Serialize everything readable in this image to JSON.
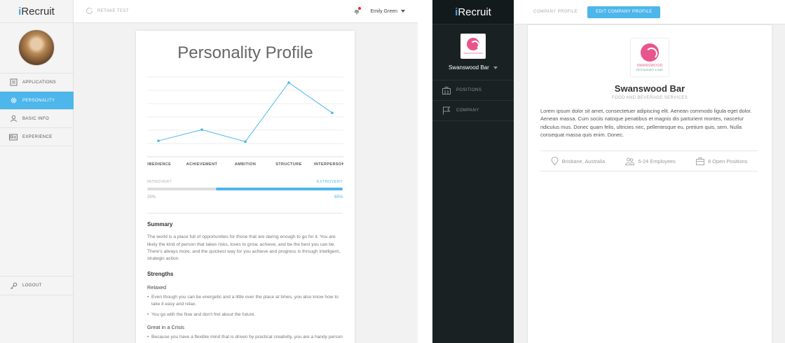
{
  "left": {
    "brand": {
      "i": "i",
      "rest": "Recruit"
    },
    "menu": [
      {
        "label": "APPLICATIONS",
        "icon": "document-icon"
      },
      {
        "label": "PERSONALITY",
        "icon": "gear-icon"
      },
      {
        "label": "BASIC INFO",
        "icon": "user-icon"
      },
      {
        "label": "EXPERIENCE",
        "icon": "id-card-icon"
      }
    ],
    "logout": "LOGOUT",
    "topbar": {
      "retake": "RETAKE TEST",
      "user": "Emily Green"
    },
    "profile": {
      "title": "Personality Profile",
      "traits": {
        "introvert_label": "INTROVERT",
        "extrovert_label": "EXTROVERT",
        "introvert_pct": "35%",
        "extrovert_pct": "65%",
        "extrovert_value": 0.65
      },
      "summary_heading": "Summary",
      "summary_text": "The world is a place full of opportunities for those that are daring enough to go for it. You are likely the kind of person that takes risks, loves to grow, achieve, and be the best you can be. There's always more, and the quickest way for you achieve and progress is through intelligent, strategic action.",
      "strengths_heading": "Strengths",
      "strengths": [
        {
          "title": "Relaxed",
          "points": [
            "Even though you can be energetic and a little over the place at times, you also know how to take it easy and relax.",
            "You go with the flow and don't fret about the future."
          ]
        },
        {
          "title": "Great in a Crisis",
          "points": [
            "Because you have a flexible mind that is driven by practical creativity, you are a handy person to have in a crisis."
          ]
        }
      ]
    }
  },
  "chart_data": {
    "type": "line",
    "categories": [
      "OBEDIENCE",
      "ACHIEVEMENT",
      "AMBITION",
      "STRUCTURE",
      "INTERPERSONAL"
    ],
    "values": [
      20,
      34,
      19,
      93,
      55
    ],
    "ylim": [
      0,
      100
    ],
    "grid": true,
    "color": "#4db6ea"
  },
  "right": {
    "brand": {
      "i": "i",
      "rest": "Recruit"
    },
    "company_name": "Swanswood Bar",
    "menu": [
      {
        "label": "POSITIONS",
        "icon": "briefcase-icon"
      },
      {
        "label": "COMPANY",
        "icon": "flag-icon"
      }
    ],
    "topbar": {
      "tab": "COMPANY PROFILE",
      "edit": "EDIT COMPANY PROFILE"
    },
    "logo": {
      "small_text": "SWANSWOOD BAR",
      "line1": "SWANSWOOD",
      "line2": "RESTAURANT & BAR"
    },
    "profile": {
      "name": "Swanswood Bar",
      "category": "FOOD AND BEVERAGE SERVICES",
      "description": "Lorem ipsum dolor sit amet, consectetuer adipiscing elit. Aenean commodo ligula eget dolor. Aenean massa. Cum sociis natoque penatibus et magnis dis parturient montes, nascetur ridiculus mus. Donec quam felis, ultricies nec, pellentesque eu, pretium quis, sem. Nulla consequat massa quis enim. Donec.",
      "location": "Brisbane, Australia",
      "employees": "5-24 Employees",
      "positions": "6 Open Positions"
    }
  },
  "colors": {
    "accent": "#4db6ea",
    "dark_sidebar": "#1a2123",
    "brand_pink": "#e8558c"
  }
}
